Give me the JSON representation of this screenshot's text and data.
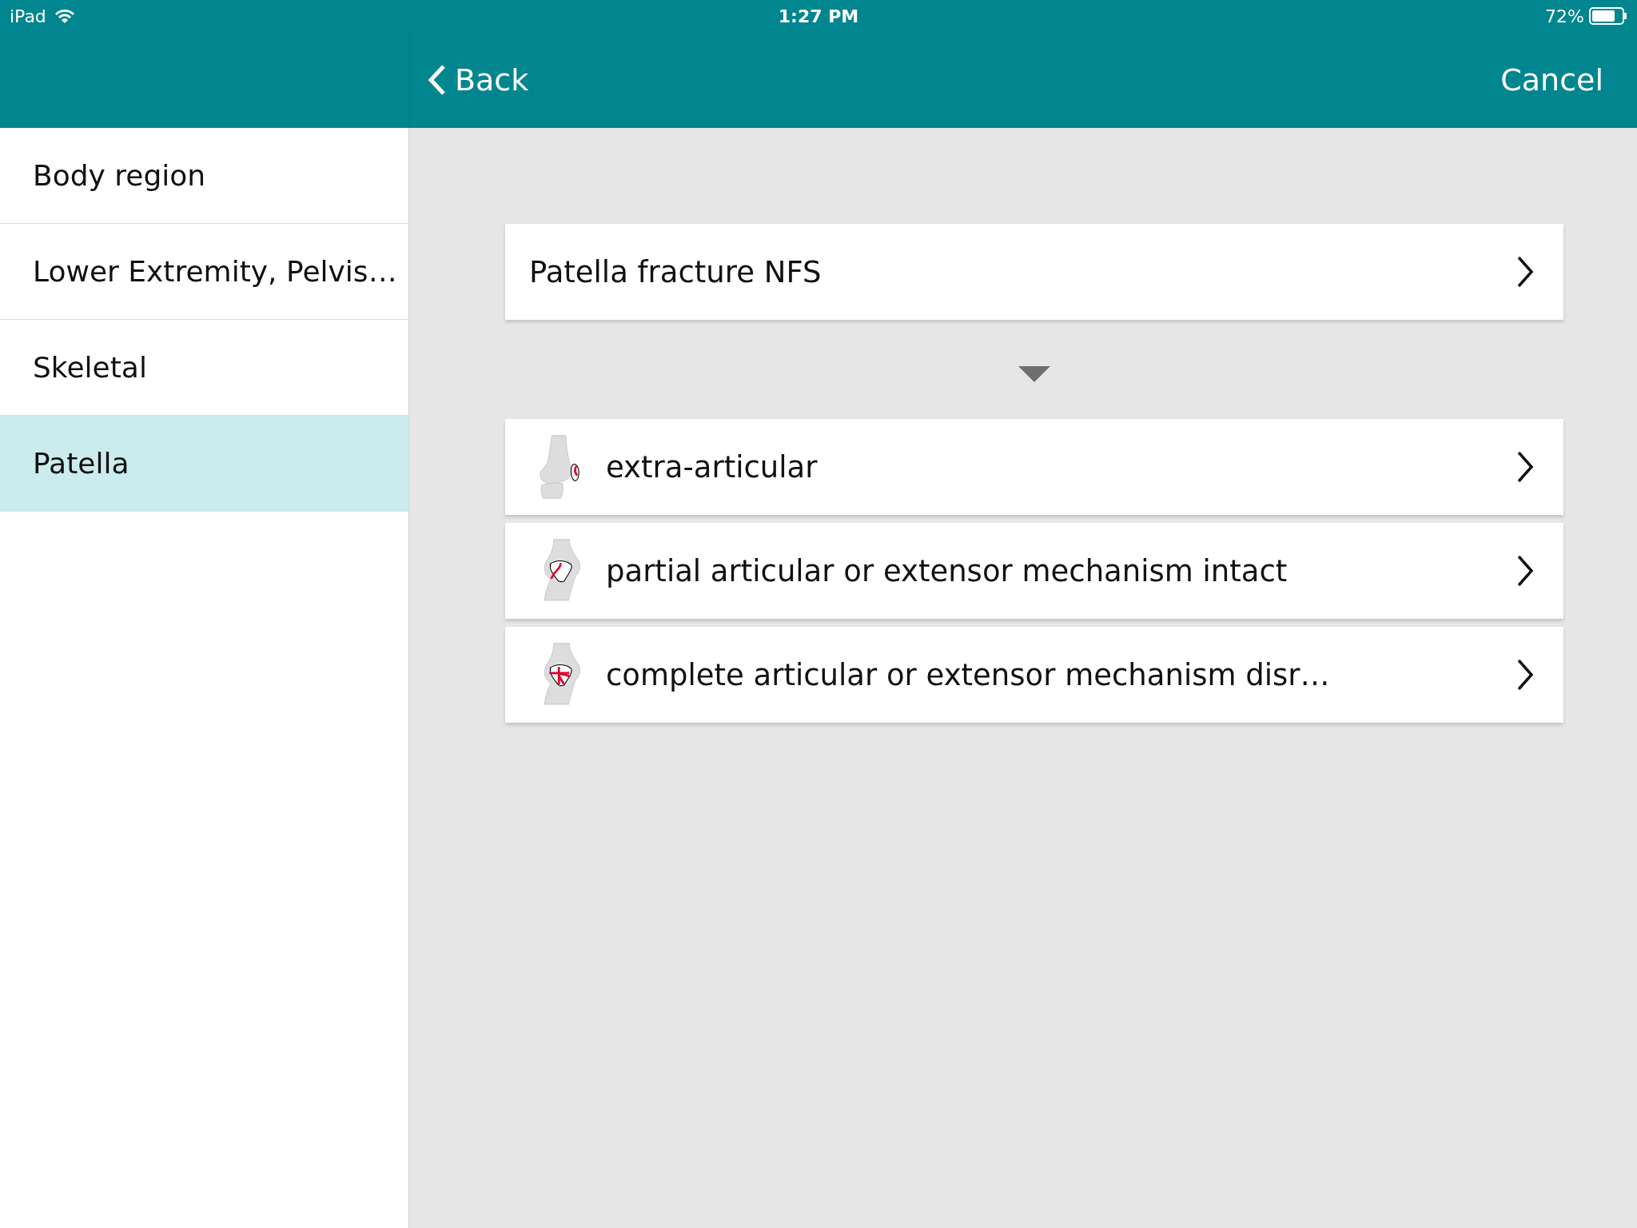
{
  "status_bar": {
    "device": "iPad",
    "time": "1:27 PM",
    "battery": "72%"
  },
  "nav_bar": {
    "back": "Back",
    "cancel": "Cancel"
  },
  "sidebar": {
    "items": [
      {
        "label": "Body region",
        "selected": false
      },
      {
        "label": "Lower Extremity, Pelvis…",
        "selected": false
      },
      {
        "label": "Skeletal",
        "selected": false
      },
      {
        "label": "Patella",
        "selected": true
      }
    ]
  },
  "main": {
    "header_option": {
      "label": "Patella fracture NFS"
    },
    "options": [
      {
        "label": "extra-articular",
        "kind": "extra"
      },
      {
        "label": "partial articular or extensor mechanism intact",
        "kind": "partial"
      },
      {
        "label": "complete articular or extensor mechanism disr…",
        "kind": "complete"
      }
    ]
  }
}
